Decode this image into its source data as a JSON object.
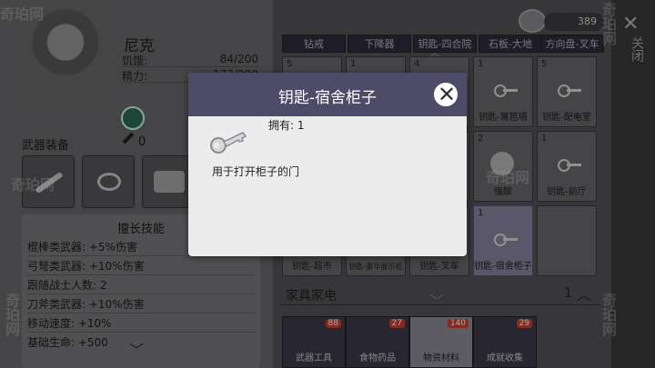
{
  "watermark": "奇珀网",
  "character": {
    "name": "尼克",
    "stats": [
      {
        "label": "饥饿:",
        "value": "84/200"
      },
      {
        "label": "精力:",
        "value": "173/200"
      }
    ]
  },
  "weapon": {
    "title": "武器装备",
    "count": "0"
  },
  "skills": {
    "title": "擅长技能",
    "rows": [
      "棍棒类武器: +5%伤害",
      "弓弩类武器: +10%伤害",
      "跟随战士人数: 2",
      "刀斧类武器: +10%伤害",
      "移动速度: +10%",
      "基础生命: +500"
    ]
  },
  "coins": "389",
  "close": {
    "label": "关闭"
  },
  "tabs": [
    "钻戒",
    "下降器",
    "钥匙-四合院",
    "石板-大地",
    "方向盘-叉车"
  ],
  "grid": [
    {
      "count": "5",
      "label": ""
    },
    {
      "count": "1",
      "label": ""
    },
    {
      "count": "4",
      "label": ""
    },
    {
      "count": "1",
      "label": "钥匙-篱笆墙"
    },
    {
      "count": "5",
      "label": "钥匙-配电室"
    },
    {
      "count": "",
      "label": ""
    },
    {
      "count": "",
      "label": ""
    },
    {
      "count": "",
      "label": ""
    },
    {
      "count": "2",
      "label": "强酸"
    },
    {
      "count": "1",
      "label": "钥匙-前厅"
    },
    {
      "count": "",
      "label": "钥匙-超市"
    },
    {
      "count": "",
      "label": "钥匙-豪华展示柜"
    },
    {
      "count": "",
      "label": "钥匙-叉车"
    },
    {
      "count": "1",
      "label": "钥匙-宿舍柜子"
    },
    {
      "count": "",
      "label": ""
    }
  ],
  "furniture": {
    "title": "家具家电",
    "count": "1"
  },
  "bottom_tabs": [
    {
      "label": "武器工具",
      "badge": "88"
    },
    {
      "label": "食物药品",
      "badge": "27"
    },
    {
      "label": "物资材料",
      "badge": "140"
    },
    {
      "label": "成就收集",
      "badge": "29"
    }
  ],
  "modal": {
    "title": "钥匙-宿舍柜子",
    "owned": "拥有: 1",
    "description": "用于打开柜子的门"
  }
}
